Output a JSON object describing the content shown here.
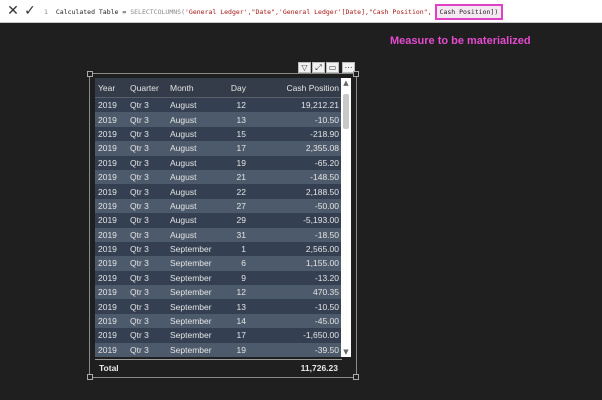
{
  "formula": {
    "line_number": "1",
    "prefix": "Calculated Table = ",
    "func": "SELECTCOLUMNS(",
    "args": "'General Ledger',\"Date\",'General Ledger'[Date],\"Cash Position\",",
    "highlighted": "Cash Position])",
    "cancel_icon": "close-icon",
    "commit_icon": "check-icon"
  },
  "callout": "Measure to be materialized",
  "colors": {
    "highlight": "#e03fc8",
    "row_dark": "#344052",
    "row_light": "#4d5a6b",
    "header": "#333c48"
  },
  "table": {
    "columns": [
      "Year",
      "Quarter",
      "Month",
      "Day",
      "Cash Position"
    ],
    "rows": [
      [
        "2019",
        "Qtr 3",
        "August",
        "12",
        "19,212.21"
      ],
      [
        "2019",
        "Qtr 3",
        "August",
        "13",
        "-10.50"
      ],
      [
        "2019",
        "Qtr 3",
        "August",
        "15",
        "-218.90"
      ],
      [
        "2019",
        "Qtr 3",
        "August",
        "17",
        "2,355.08"
      ],
      [
        "2019",
        "Qtr 3",
        "August",
        "19",
        "-65.20"
      ],
      [
        "2019",
        "Qtr 3",
        "August",
        "21",
        "-148.50"
      ],
      [
        "2019",
        "Qtr 3",
        "August",
        "22",
        "2,188.50"
      ],
      [
        "2019",
        "Qtr 3",
        "August",
        "27",
        "-50.00"
      ],
      [
        "2019",
        "Qtr 3",
        "August",
        "29",
        "-5,193.00"
      ],
      [
        "2019",
        "Qtr 3",
        "August",
        "31",
        "-18.50"
      ],
      [
        "2019",
        "Qtr 3",
        "September",
        "1",
        "2,565.00"
      ],
      [
        "2019",
        "Qtr 3",
        "September",
        "6",
        "1,155.00"
      ],
      [
        "2019",
        "Qtr 3",
        "September",
        "9",
        "-13.20"
      ],
      [
        "2019",
        "Qtr 3",
        "September",
        "12",
        "470.35"
      ],
      [
        "2019",
        "Qtr 3",
        "September",
        "13",
        "-10.50"
      ],
      [
        "2019",
        "Qtr 3",
        "September",
        "14",
        "-45.00"
      ],
      [
        "2019",
        "Qtr 3",
        "September",
        "17",
        "-1,650.00"
      ],
      [
        "2019",
        "Qtr 3",
        "September",
        "19",
        "-39.50"
      ]
    ],
    "total_label": "Total",
    "total_value": "11,726.23"
  },
  "toolbar_icons": [
    "filter-icon",
    "focus-mode-icon",
    "more-options-icon"
  ],
  "toolbar_glyphs": {
    "filter": "▽",
    "focus": "⤢",
    "more": "⋯"
  },
  "scroll_glyphs": {
    "up": "▲",
    "down": "▼"
  }
}
